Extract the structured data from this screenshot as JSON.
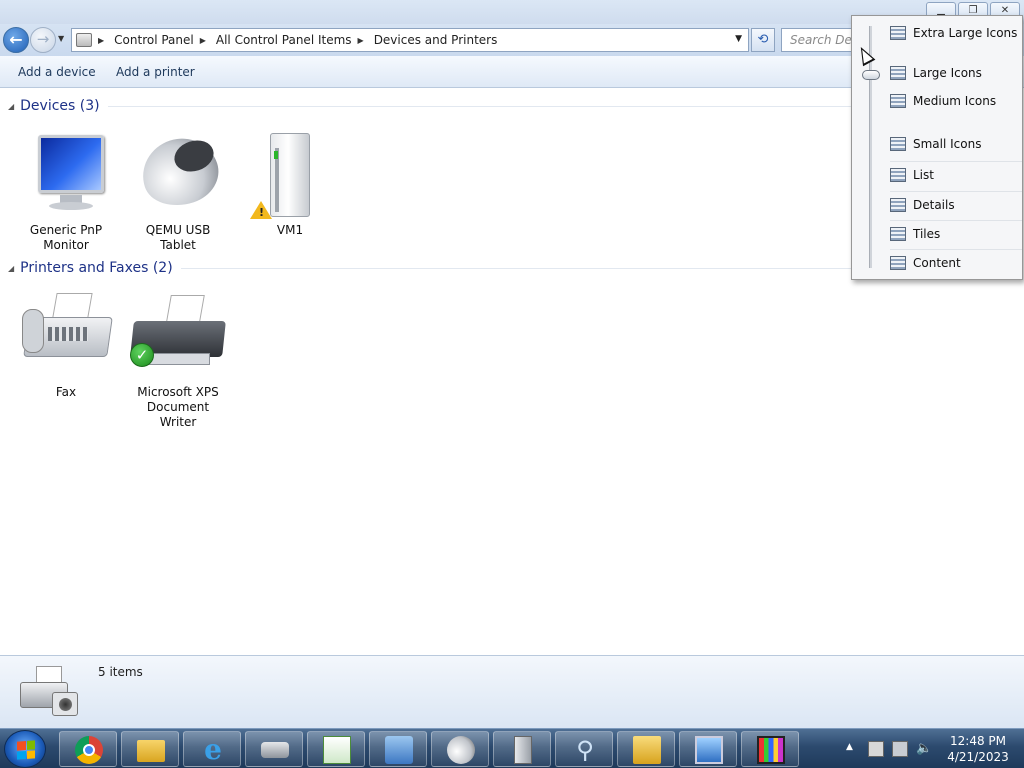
{
  "window": {
    "minimize_icon": "minimize-icon",
    "restore_icon": "restore-icon",
    "close_icon": "close-icon"
  },
  "navigation": {
    "back_glyph": "←",
    "forward_glyph": "→",
    "breadcrumbs": [
      "Control Panel",
      "All Control Panel Items",
      "Devices and Printers"
    ],
    "search_placeholder": "Search Devi"
  },
  "toolbar": {
    "add_device_label": "Add a device",
    "add_printer_label": "Add a printer"
  },
  "groups": [
    {
      "title": "Devices (3)",
      "items": [
        {
          "label": "Generic PnP Monitor",
          "icon": "monitor-icon"
        },
        {
          "label": "QEMU USB Tablet",
          "icon": "mouse-icon"
        },
        {
          "label": "VM1",
          "icon": "computer-drive-icon",
          "status": "warning"
        }
      ]
    },
    {
      "title": "Printers and Faxes (2)",
      "items": [
        {
          "label": "Fax",
          "icon": "fax-icon"
        },
        {
          "label": "Microsoft XPS Document Writer",
          "icon": "printer-icon",
          "status": "default"
        }
      ]
    }
  ],
  "details": {
    "count": "5 items"
  },
  "view_menu": {
    "items": [
      "Extra Large Icons",
      "Large Icons",
      "Medium Icons",
      "Small Icons",
      "List",
      "Details",
      "Tiles",
      "Content"
    ],
    "selected": "Large Icons"
  },
  "taskbar": {
    "apps": [
      "chrome-icon",
      "explorer-icon",
      "internet-explorer-icon",
      "devices-icon",
      "notepad-icon",
      "control-panel-icon",
      "mouse-icon",
      "server-icon",
      "search-icon",
      "folder-icon",
      "remote-desktop-icon",
      "display-icon"
    ],
    "clock_time": "12:48 PM",
    "clock_date": "4/21/2023"
  },
  "colors": {
    "group_header": "#1e3287",
    "taskbar": "#2c4a6e",
    "accent": "#1f5fb5"
  }
}
